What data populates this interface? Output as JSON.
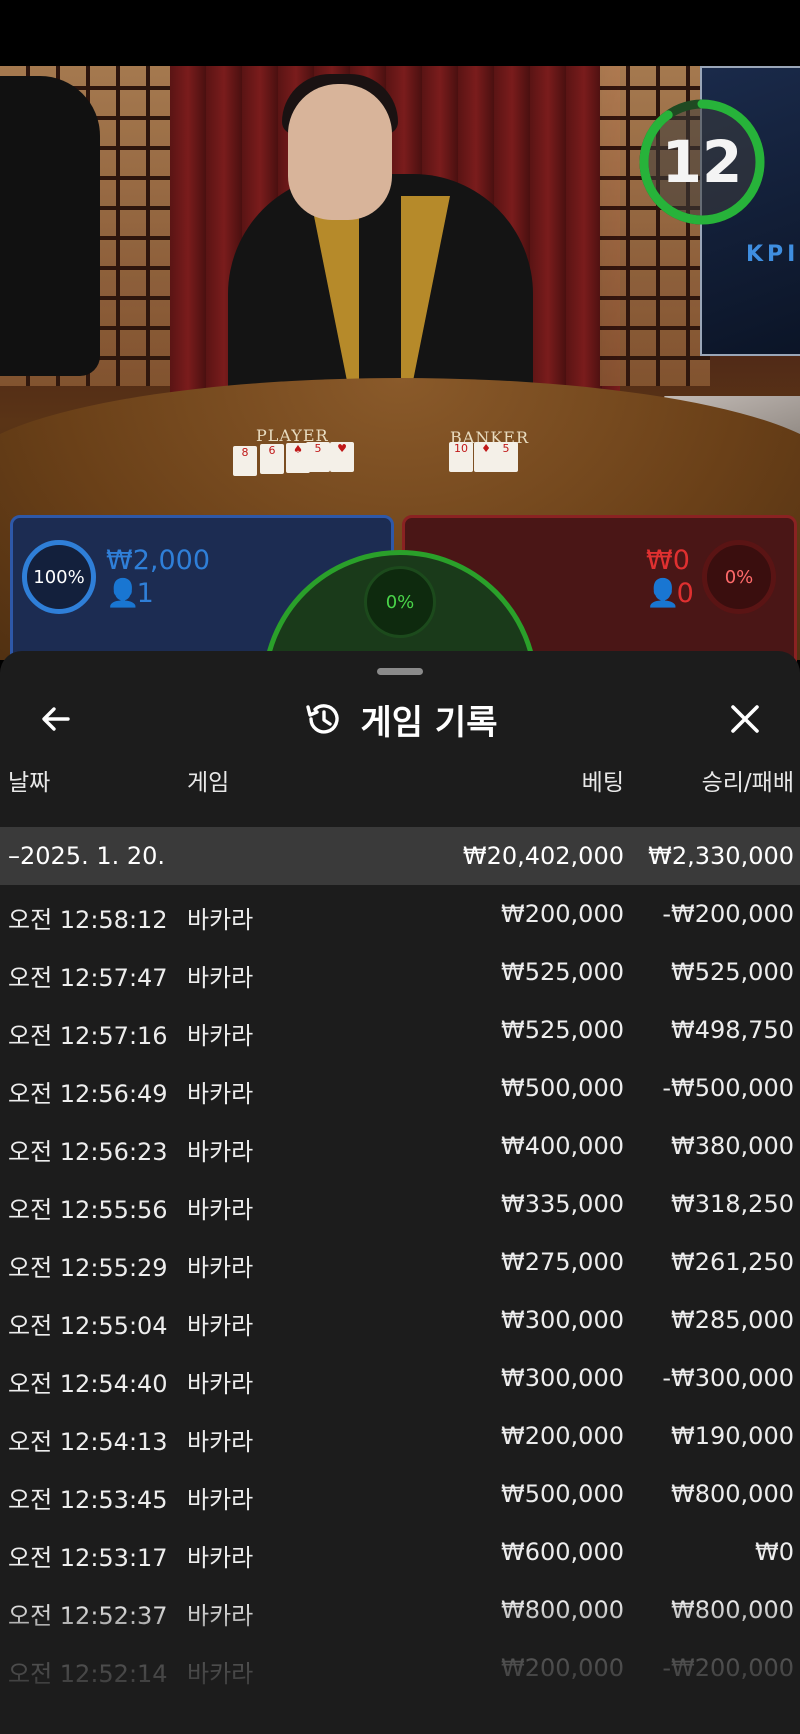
{
  "video": {
    "timer": "12",
    "screen_text": "KPI",
    "labels": {
      "player": "PLAYER",
      "banker": "BANKER"
    },
    "player_bet": {
      "percent": "100%",
      "amount": "₩2,000",
      "players": "1",
      "color": "#2e58a8"
    },
    "banker_bet": {
      "percent": "0%",
      "amount": "₩0",
      "players": "0",
      "color": "#8a2222"
    },
    "tie_bet": {
      "percent": "0%",
      "color": "#2aa02a"
    },
    "timer_fraction": 0.9
  },
  "sheet": {
    "title": "게임 기록",
    "columns": {
      "date": "날짜",
      "game": "게임",
      "bet": "베팅",
      "result": "승리/패배"
    },
    "date_row": {
      "date": "–2025. 1. 20.",
      "bet": "₩20,402,000",
      "result": "₩2,330,000"
    },
    "rows": [
      {
        "time": "오전 12:58:12",
        "game": "바카라",
        "bet": "₩200,000",
        "result": "-₩200,000"
      },
      {
        "time": "오전 12:57:47",
        "game": "바카라",
        "bet": "₩525,000",
        "result": "₩525,000"
      },
      {
        "time": "오전 12:57:16",
        "game": "바카라",
        "bet": "₩525,000",
        "result": "₩498,750"
      },
      {
        "time": "오전 12:56:49",
        "game": "바카라",
        "bet": "₩500,000",
        "result": "-₩500,000"
      },
      {
        "time": "오전 12:56:23",
        "game": "바카라",
        "bet": "₩400,000",
        "result": "₩380,000"
      },
      {
        "time": "오전 12:55:56",
        "game": "바카라",
        "bet": "₩335,000",
        "result": "₩318,250"
      },
      {
        "time": "오전 12:55:29",
        "game": "바카라",
        "bet": "₩275,000",
        "result": "₩261,250"
      },
      {
        "time": "오전 12:55:04",
        "game": "바카라",
        "bet": "₩300,000",
        "result": "₩285,000"
      },
      {
        "time": "오전 12:54:40",
        "game": "바카라",
        "bet": "₩300,000",
        "result": "-₩300,000"
      },
      {
        "time": "오전 12:54:13",
        "game": "바카라",
        "bet": "₩200,000",
        "result": "₩190,000"
      },
      {
        "time": "오전 12:53:45",
        "game": "바카라",
        "bet": "₩500,000",
        "result": "₩800,000"
      },
      {
        "time": "오전 12:53:17",
        "game": "바카라",
        "bet": "₩600,000",
        "result": "₩0"
      },
      {
        "time": "오전 12:52:37",
        "game": "바카라",
        "bet": "₩800,000",
        "result": "₩800,000"
      },
      {
        "time": "오전 12:52:14",
        "game": "바카라",
        "bet": "₩200,000",
        "result": "-₩200,000"
      }
    ],
    "icons": {
      "back": "arrow-left-icon",
      "history": "history-icon",
      "close": "close-icon"
    }
  }
}
